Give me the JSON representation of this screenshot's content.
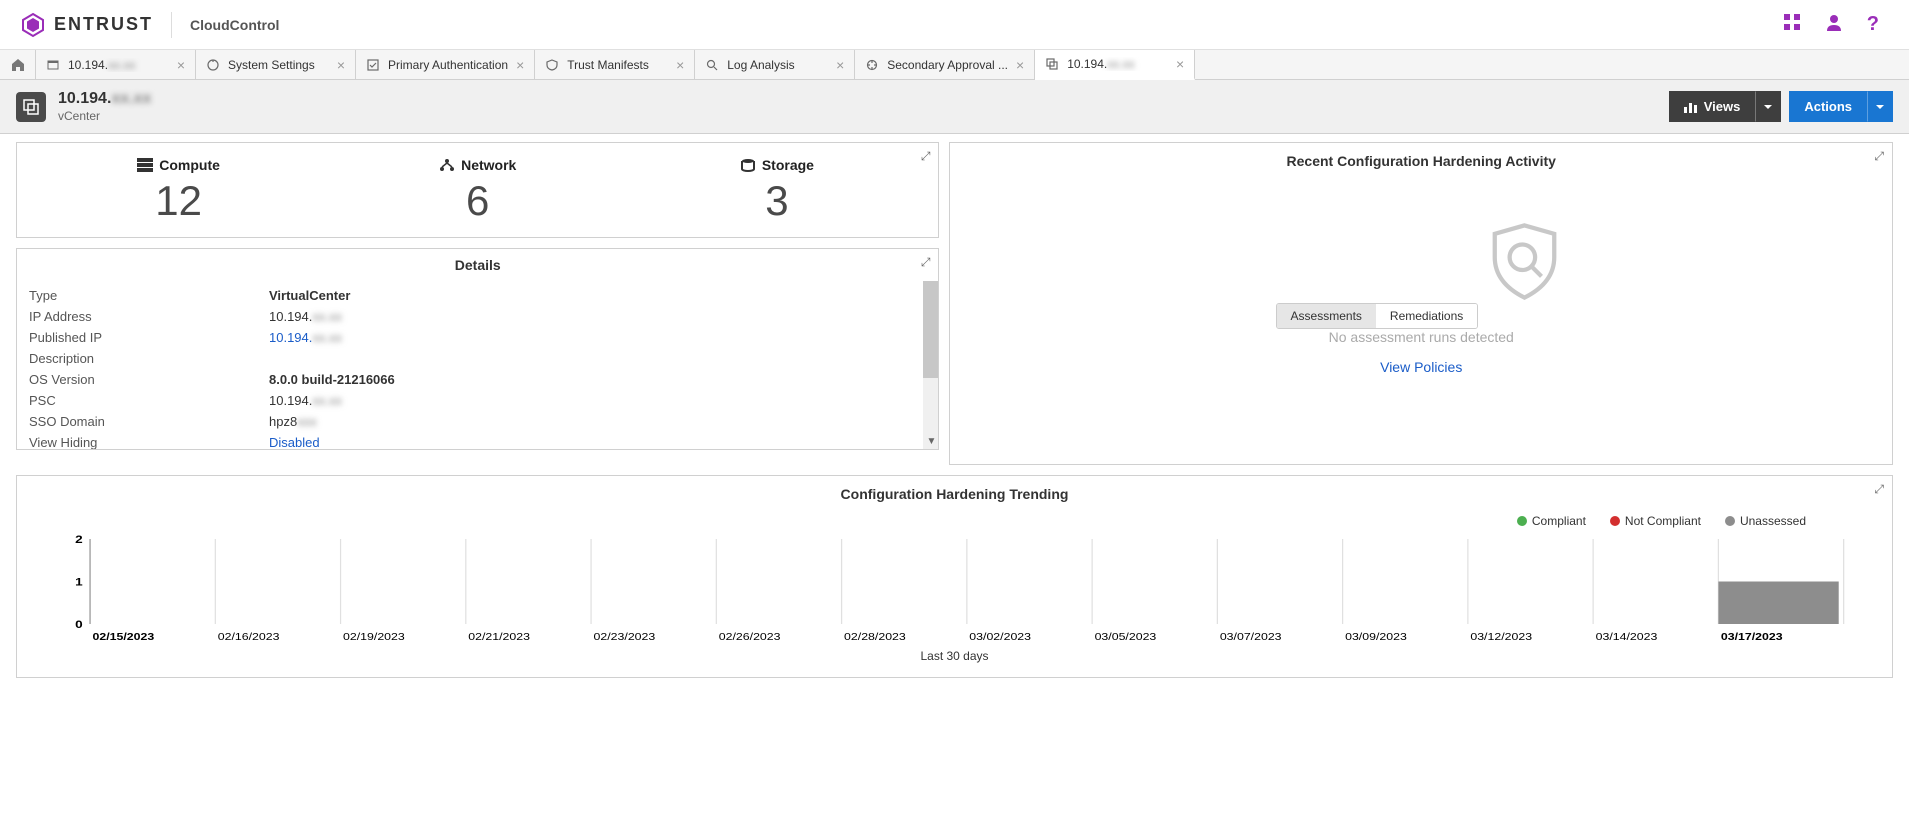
{
  "header": {
    "logo_text": "ENTRUST",
    "app_name": "CloudControl"
  },
  "tabs": [
    {
      "label": "10.194.",
      "blur": "xx.xx"
    },
    {
      "label": "System Settings"
    },
    {
      "label": "Primary Authentication"
    },
    {
      "label": "Trust Manifests"
    },
    {
      "label": "Log Analysis"
    },
    {
      "label": "Secondary Approval ..."
    },
    {
      "label": "10.194.",
      "blur": "xx.xx",
      "active": true
    }
  ],
  "context": {
    "title": "10.194.",
    "title_blur": "xx.xx",
    "subtitle": "vCenter",
    "views_btn": "Views",
    "actions_btn": "Actions"
  },
  "stats": {
    "compute_label": "Compute",
    "compute_value": "12",
    "network_label": "Network",
    "network_value": "6",
    "storage_label": "Storage",
    "storage_value": "3"
  },
  "details": {
    "title": "Details",
    "rows": [
      {
        "label": "Type",
        "value": "VirtualCenter",
        "bold": true
      },
      {
        "label": "IP Address",
        "value": "10.194.",
        "blur": "xx.xx"
      },
      {
        "label": "Published IP",
        "value": "10.194.",
        "blur": "xx.xx",
        "link": true
      },
      {
        "label": "Description",
        "value": ""
      },
      {
        "label": "OS Version",
        "value": "8.0.0 build-21216066",
        "bold": true
      },
      {
        "label": "PSC",
        "value": "10.194.",
        "blur": "xx.xx"
      },
      {
        "label": "SSO Domain",
        "value": "hpz8",
        "blur": "xxx"
      },
      {
        "label": "View Hiding",
        "value": "Disabled",
        "link": true
      }
    ]
  },
  "assessment": {
    "title": "Recent Configuration Hardening Activity",
    "tab_assessments": "Assessments",
    "tab_remediations": "Remediations",
    "empty_text": "No assessment runs detected",
    "view_policies": "View Policies"
  },
  "chart": {
    "title": "Configuration Hardening Trending",
    "legend_compliant": "Compliant",
    "legend_notcompliant": "Not Compliant",
    "legend_unassessed": "Unassessed",
    "xlabel": "Last 30 days"
  },
  "chart_data": {
    "type": "bar",
    "categories": [
      "02/15/2023",
      "02/16/2023",
      "02/19/2023",
      "02/21/2023",
      "02/23/2023",
      "02/26/2023",
      "02/28/2023",
      "03/02/2023",
      "03/05/2023",
      "03/07/2023",
      "03/09/2023",
      "03/12/2023",
      "03/14/2023",
      "03/17/2023"
    ],
    "series": [
      {
        "name": "Compliant",
        "color": "#4caf50",
        "values": [
          0,
          0,
          0,
          0,
          0,
          0,
          0,
          0,
          0,
          0,
          0,
          0,
          0,
          0
        ]
      },
      {
        "name": "Not Compliant",
        "color": "#d32f2f",
        "values": [
          0,
          0,
          0,
          0,
          0,
          0,
          0,
          0,
          0,
          0,
          0,
          0,
          0,
          0
        ]
      },
      {
        "name": "Unassessed",
        "color": "#8d8d8d",
        "values": [
          0,
          0,
          0,
          0,
          0,
          0,
          0,
          0,
          0,
          0,
          0,
          0,
          0,
          1
        ]
      }
    ],
    "ylim": [
      0,
      2
    ],
    "yticks": [
      0,
      1,
      2
    ],
    "xlabel": "Last 30 days",
    "title": "Configuration Hardening Trending"
  },
  "colors": {
    "accent": "#9a2db8",
    "primary": "#1976d2",
    "compliant": "#4caf50",
    "notcompliant": "#d32f2f",
    "unassessed": "#8d8d8d"
  }
}
